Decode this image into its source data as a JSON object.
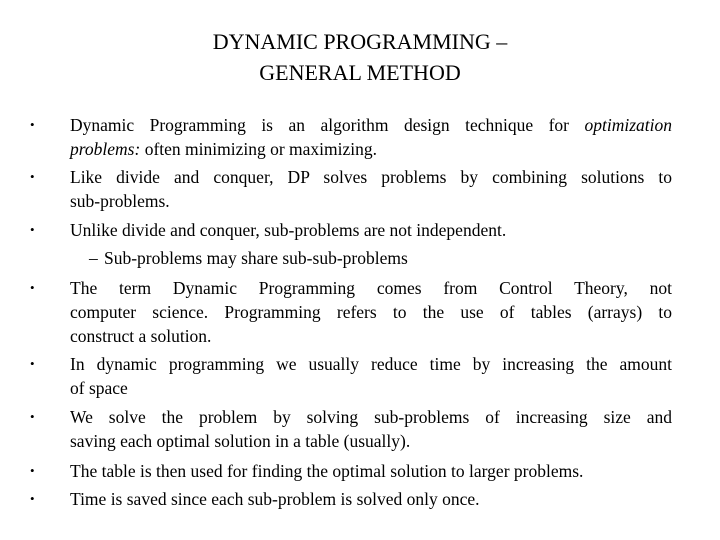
{
  "slide": {
    "title_line1": "DYNAMIC PROGRAMMING –",
    "title_line2": "GENERAL METHOD",
    "bullet_glyph": "•",
    "dash_glyph": "–",
    "bullets": [
      {
        "lines": [
          {
            "pre": "Dynamic Programming is an algorithm design technique for ",
            "em": "optimization"
          },
          {
            "em": "problems:",
            "post": " often minimizing or maximizing."
          }
        ]
      },
      {
        "lines": [
          "Like divide and conquer, DP solves problems by combining solutions to",
          "sub-problems."
        ]
      },
      {
        "lines": [
          "Unlike divide and conquer, sub-problems are not independent."
        ],
        "subitems": [
          "Sub-problems may share sub-sub-problems"
        ]
      },
      {
        "lines": [
          "The term Dynamic Programming comes from Control Theory, not",
          "computer science. Programming refers to the use of tables (arrays) to",
          "construct a solution."
        ]
      },
      {
        "lines": [
          "In dynamic programming we usually reduce time by increasing the amount",
          "of space"
        ]
      },
      {
        "lines": [
          "We solve the problem by solving sub-problems of increasing size and",
          "saving each optimal solution in a table (usually)."
        ]
      },
      {
        "lines": [
          "The table is then used for finding the optimal solution to larger problems."
        ]
      },
      {
        "lines": [
          "Time is saved since each sub-problem is solved only once."
        ]
      }
    ]
  }
}
